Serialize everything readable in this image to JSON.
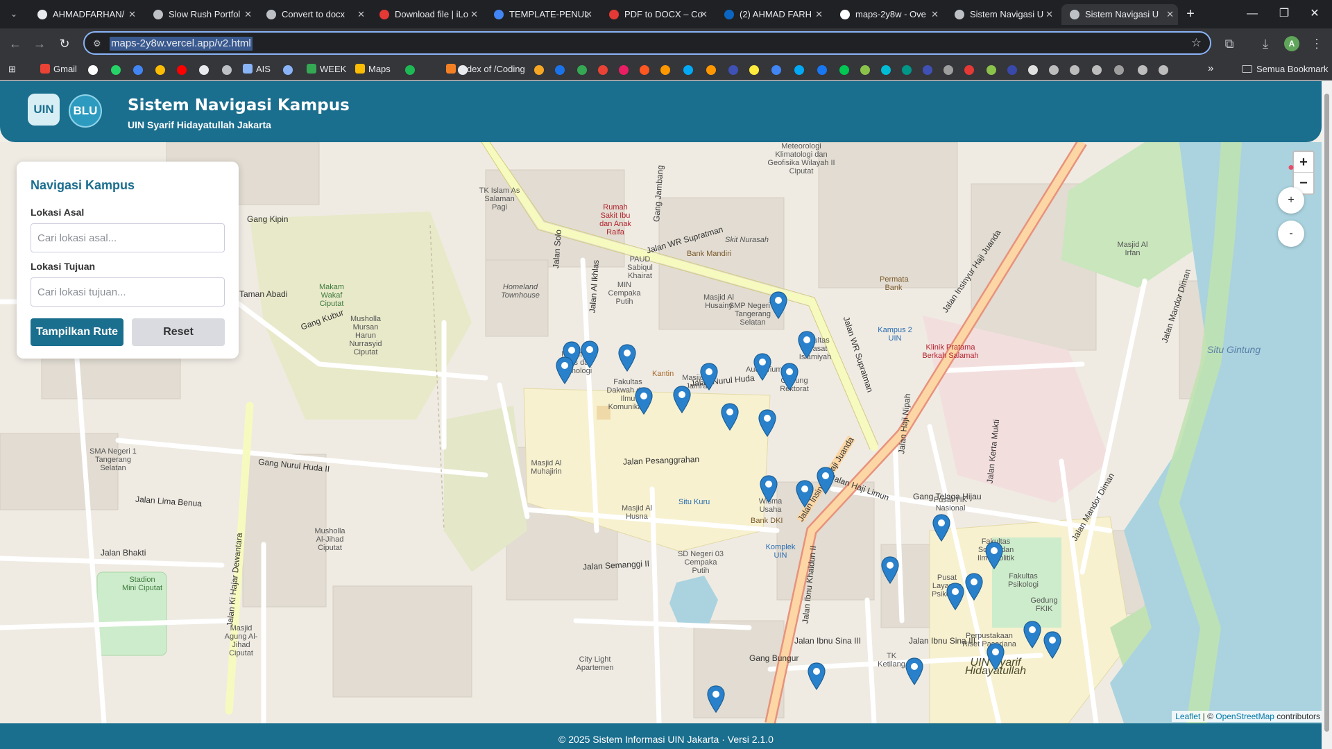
{
  "browser": {
    "tabs": [
      {
        "title": "AHMADFARHAN/",
        "color": "#e8eaed"
      },
      {
        "title": "Slow Rush Portfol",
        "color": "#bdc1c6"
      },
      {
        "title": "Convert to docx",
        "color": "#bdc1c6"
      },
      {
        "title": "Download file | iLo",
        "color": "#e53935"
      },
      {
        "title": "TEMPLATE-PENUL",
        "color": "#4285f4"
      },
      {
        "title": "PDF to DOCX – Co",
        "color": "#e53935"
      },
      {
        "title": "(2) AHMAD FARH",
        "color": "#0a66c2"
      },
      {
        "title": "maps-2y8w - Ove",
        "color": "#ffffff"
      },
      {
        "title": "Sistem Navigasi U",
        "color": "#bdc1c6"
      },
      {
        "title": "Sistem Navigasi U",
        "color": "#bdc1c6"
      }
    ],
    "active_tab_index": 9,
    "url": "maps-2y8w.vercel.app/v2.html",
    "profile_initial": "A",
    "bookmarks": {
      "gmail": "Gmail",
      "ais": "AIS",
      "week": "WEEK",
      "maps": "Maps",
      "coding": "Index of /Coding",
      "all": "Semua Bookmark"
    }
  },
  "app": {
    "logo_uin": "UIN",
    "logo_blu": "BLU",
    "title": "Sistem Navigasi Kampus",
    "subtitle": "UIN Syarif Hidayatullah Jakarta"
  },
  "panel": {
    "title": "Navigasi Kampus",
    "origin_label": "Lokasi Asal",
    "origin_placeholder": "Cari lokasi asal...",
    "origin_value": "",
    "dest_label": "Lokasi Tujuan",
    "dest_placeholder": "Cari lokasi tujuan...",
    "dest_value": "",
    "show_route": "Tampilkan Rute",
    "reset": "Reset"
  },
  "map": {
    "zoom_in": "+",
    "zoom_out": "−",
    "plus": "+",
    "minus": "-",
    "attribution_leaflet": "Leaflet",
    "attribution_sep": " | © ",
    "attribution_osm": "OpenStreetMap",
    "attribution_rest": " contributors",
    "labels": {
      "jalan_wr_supratman": "Jalan WR Supratman",
      "jalan_ir_juanda": "Jalan Insinyur Haji Juanda",
      "jalan_nurul_huda": "Jalan Nurul Huda",
      "jalan_pesanggrahan": "Jalan Pesanggrahan",
      "jalan_ki_hajar": "Jalan Ki Hajar Dewantara",
      "jalan_lima_benua": "Jalan Lima Benua",
      "jalan_bhakti": "Jalan Bhakti",
      "jalan_semanggi": "Jalan Semanggi II",
      "jalan_ibnu_sina": "Jalan Ibnu Sina III",
      "jalan_haji_limun": "Jalan Haji Limun",
      "jalan_mandor_diman": "Jalan Mandor Diman",
      "gang_telaga_hijau": "Gang Telaga Hijau",
      "gang_kipin": "Gang Kipin",
      "gang_kubur": "Gang Kubur",
      "gang_nurul_huda_ii": "Gang Nurul Huda II",
      "taman_abadi": "Taman Abadi",
      "situ_gintung": "Situ Gintung",
      "situ_kuru": "Situ Kuru",
      "uin": "UIN Syarif Hidayatullah",
      "rs": "Rumah Sakit Ibu dan Anak Raifa",
      "klinik": "Klinik Pratama Berkah Salamah",
      "fak_sains": "Fakultas Sains dan Teknologi",
      "fak_dakwah": "Fakultas Dakwah dan Ilmu Komunikasi",
      "fak_dirasat": "Fakultas Dirasat Islamiyah",
      "auditorium": "Auditorium",
      "gedung_rektorat": "Gedung Rektorat",
      "masjid_al_jamiah": "Masjid Al-Jami'ah",
      "kantin": "Kantin",
      "pusat_tik": "Pusat TIK Nasional",
      "pusat_layanan": "Pusat Layanan Psikologi",
      "fak_psikologi": "Fakultas Psikologi",
      "kampus_2": "Kampus 2 UIN",
      "komplek_uin": "Komplek UIN",
      "bank_dki": "Bank DKI",
      "bank_mandiri": "Bank Mandiri",
      "permata": "Permata Bank",
      "masjid_al_husainy": "Masjid Al Husainy",
      "masjid_al_husna": "Masjid Al Husna",
      "masjid_al_muhajirin": "Masjid Al Muhajirin",
      "masjid_al_irfan": "Masjid Al Irfan",
      "masjid_agung": "Masjid Agung Al-Jihad Ciputat",
      "musholla_jihad": "Musholla Al-Jihad Ciputat",
      "musholla_mursan": "Musholla Mursan Harun Nurrasyid Ciputat",
      "makam": "Makam Wakaf Ciputat",
      "stadion": "Stadion Mini Ciputat",
      "bmkg": "Meteorologi Klimatologi dan Geofisika Wilayah II Ciputat",
      "smp3": "SMP Negeri 3 Tangerang Selatan",
      "sma1": "SMA Negeri 1 Tangerang Selatan",
      "sd03": "SD Negeri 03 Cempaka Putih",
      "tk_islam": "TK Islam As Salaman Pagi",
      "paud": "PAUD Sabiqul Khairat",
      "min": "MIN Cempaka Putih",
      "homeland": "Homeland Townhouse",
      "city_light": "City Light Apartemen",
      "skynutraschi": "Skit Nurasah",
      "wisma": "Wisma Usaha",
      "jalan_haji_nipah": "Jalan Haji Nipah",
      "jalan_kerta_mukti": "Jalan Kerta Mukti",
      "jalan_solo": "Jalan Solo",
      "jalan_al_ikhlas": "Jalan Al Ikhlas",
      "gang_jambang": "Gang Jambang",
      "jalan_ibnu_khaldun": "Jalan Ibnu Khaldun II",
      "gang_bungur": "Gang Bungur",
      "tk_ketilang": "TK Ketilang",
      "perpustakaan": "Perpustakaan Riset Pasarjana",
      "fakultas_sosial": "Fakultas Sosial dan Ilmu Politik",
      "gedung_fkik": "Gedung FKIK"
    }
  },
  "footer": {
    "text": "© 2025 Sistem Informasi UIN Jakarta   ·   Versi 2.1.0"
  }
}
